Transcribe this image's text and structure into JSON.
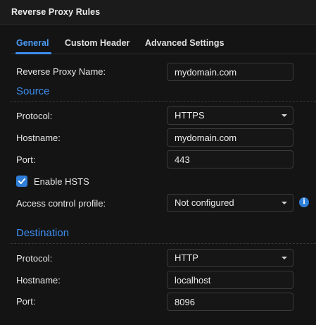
{
  "window": {
    "title": "Reverse Proxy Rules"
  },
  "tabs": [
    {
      "label": "General",
      "active": true
    },
    {
      "label": "Custom Header",
      "active": false
    },
    {
      "label": "Advanced Settings",
      "active": false
    }
  ],
  "general": {
    "name_label": "Reverse Proxy Name:",
    "name_value": "mydomain.com"
  },
  "source": {
    "heading": "Source",
    "protocol_label": "Protocol:",
    "protocol_value": "HTTPS",
    "hostname_label": "Hostname:",
    "hostname_value": "mydomain.com",
    "port_label": "Port:",
    "port_value": "443",
    "hsts_label": "Enable HSTS",
    "hsts_checked": true,
    "acl_label": "Access control profile:",
    "acl_value": "Not configured",
    "info_icon": "info-icon"
  },
  "destination": {
    "heading": "Destination",
    "protocol_label": "Protocol:",
    "protocol_value": "HTTP",
    "hostname_label": "Hostname:",
    "hostname_value": "localhost",
    "port_label": "Port:",
    "port_value": "8096"
  },
  "colors": {
    "accent": "#3d8ef0",
    "background": "#141414"
  }
}
